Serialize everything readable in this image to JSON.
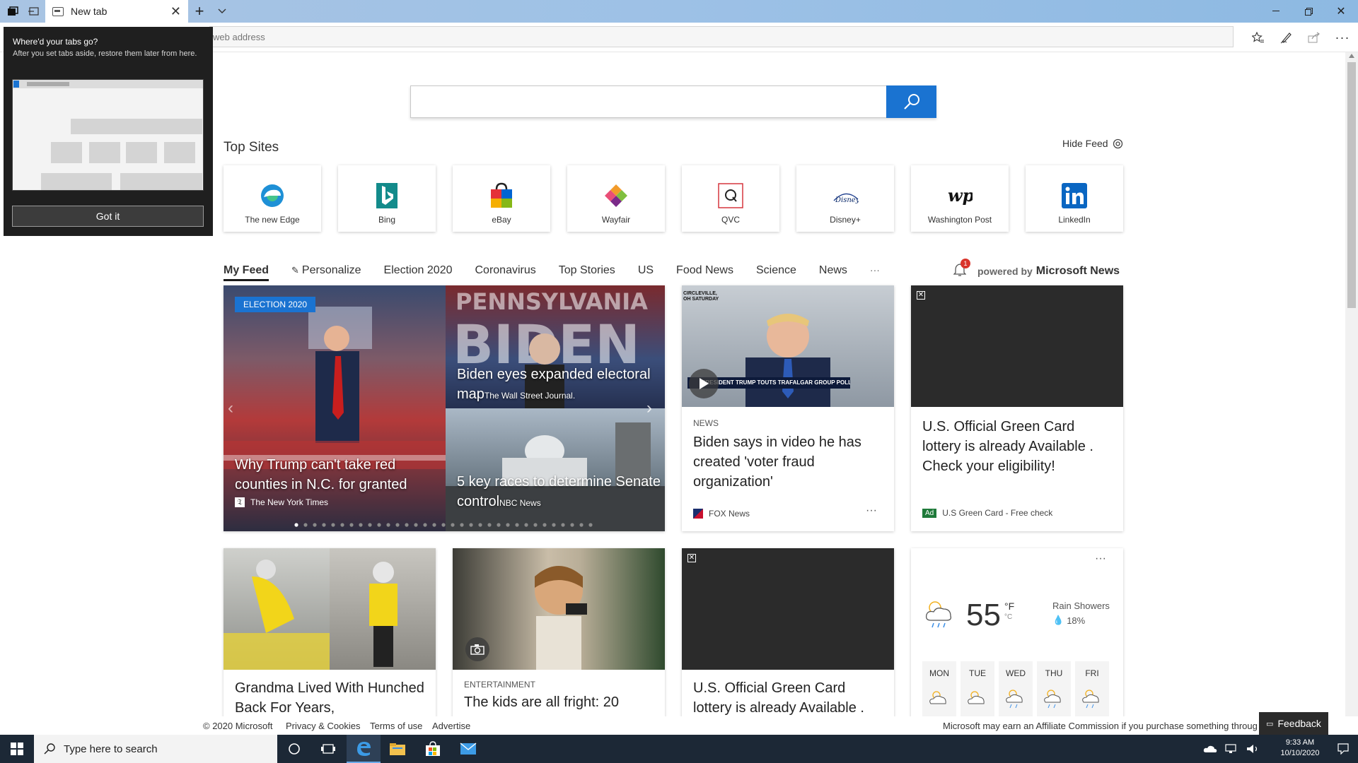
{
  "tab": {
    "title": "New tab"
  },
  "address": {
    "placeholder": "web address"
  },
  "popup": {
    "title": "Where'd your tabs go?",
    "body": "After you set tabs aside, restore them later from here.",
    "button": "Got it"
  },
  "top_sites": {
    "title": "Top Sites",
    "hide_feed": "Hide Feed",
    "items": [
      {
        "label": "The new Edge",
        "icon": "edge-icon"
      },
      {
        "label": "Bing",
        "icon": "bing-icon"
      },
      {
        "label": "eBay",
        "icon": "ebay-icon"
      },
      {
        "label": "Wayfair",
        "icon": "wayfair-icon"
      },
      {
        "label": "QVC",
        "icon": "qvc-icon"
      },
      {
        "label": "Disney+",
        "icon": "disney-icon"
      },
      {
        "label": "Washington Post",
        "icon": "wapo-icon"
      },
      {
        "label": "LinkedIn",
        "icon": "linkedin-icon"
      }
    ]
  },
  "feed": {
    "tabs": [
      "My Feed",
      "Personalize",
      "Election 2020",
      "Coronavirus",
      "Top Stories",
      "US",
      "Food News",
      "Science",
      "News",
      "···"
    ],
    "notification_count": "1",
    "powered_by": "powered by",
    "powered_brand": "Microsoft News"
  },
  "cards": {
    "carousel": {
      "badge": "ELECTION 2020",
      "main_headline": "Why Trump can't take red counties in N.C. for granted",
      "main_source": "The New York Times",
      "right_top_headline": "Biden eyes expanded electoral map",
      "right_top_source": "The Wall Street Journal.",
      "right_bottom_headline": "5 key races to determine Senate control",
      "right_bottom_source": "NBC News"
    },
    "biden_video": {
      "kicker": "NEWS",
      "headline": "Biden says in video he has created 'voter fraud organization'",
      "source": "FOX News",
      "chyron": "PRESIDENT TRUMP TOUTS TRAFALGAR GROUP POLLS",
      "corner": "CIRCLEVILLE, OH SATURDAY"
    },
    "ad1": {
      "headline": "U.S. Official Green Card lottery is already Available . Check your eligibility!",
      "ad_label": "Ad",
      "source": "U.S Green Card - Free check"
    },
    "grandma": {
      "headline": "Grandma Lived With Hunched Back For Years,"
    },
    "kids": {
      "kicker": "ENTERTAINMENT",
      "headline": "The kids are all fright: 20"
    },
    "ad2": {
      "headline": "U.S. Official Green Card lottery is already Available ."
    },
    "weather": {
      "temp": "55",
      "unit_f": "°F",
      "unit_c": "°C",
      "condition": "Rain Showers",
      "precip": "18%",
      "days": [
        "MON",
        "TUE",
        "WED",
        "THU",
        "FRI"
      ]
    }
  },
  "footer": {
    "copyright": "© 2020 Microsoft",
    "privacy": "Privacy & Cookies",
    "terms": "Terms of use",
    "advertise": "Advertise",
    "affiliate": "Microsoft may earn an Affiliate Commission if you purchase something throug",
    "feedback": "Feedback"
  },
  "taskbar": {
    "search_placeholder": "Type here to search",
    "time": "9:33 AM",
    "date": "10/10/2020"
  },
  "colors": {
    "accent": "#1a73d1",
    "taskbar": "#1c2836"
  }
}
